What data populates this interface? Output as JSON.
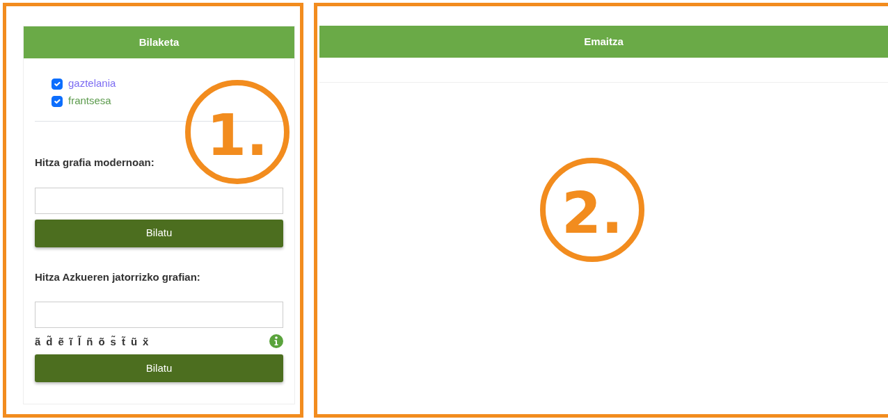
{
  "search_panel": {
    "title": "Bilaketa",
    "languages": [
      {
        "label": "gaztelania",
        "checked": true,
        "color": "#7c6cf2"
      },
      {
        "label": "frantsesa",
        "checked": true,
        "color": "#5b9a4c"
      }
    ],
    "modern_search": {
      "label": "Hitza grafia modernoan:",
      "button": "Bilatu"
    },
    "original_search": {
      "label": "Hitza Azkueren jatorrizko grafian:",
      "special_characters": [
        "ã",
        "d̃",
        "ẽ",
        "ĩ",
        "l̃",
        "ñ",
        "õ",
        "s̃",
        "t̃",
        "ũ",
        "x̃"
      ],
      "button": "Bilatu"
    },
    "annotation": "1."
  },
  "results_panel": {
    "title": "Emaitza",
    "annotation": "2."
  }
}
